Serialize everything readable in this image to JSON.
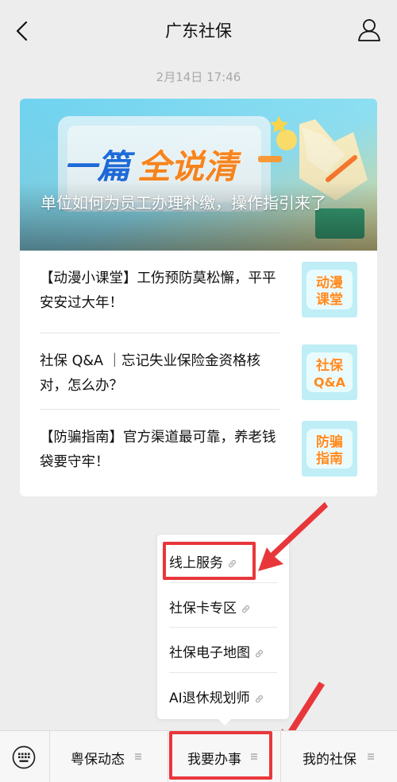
{
  "header": {
    "title": "广东社保"
  },
  "timestamp": "2月14日 17:46",
  "banner": {
    "headline": "一篇全说清",
    "caption": "单位如何为员工办理补缴，操作指引来了"
  },
  "articles": [
    {
      "title": "【动漫小课堂】工伤预防莫松懈，平平安安过大年！",
      "thumb_text": "动漫课堂"
    },
    {
      "title": "社保 Q&A ｜忘记失业保险金资格核对，怎么办？",
      "thumb_text": "社保Q&A"
    },
    {
      "title": "【防骗指南】官方渠道最可靠，养老钱袋要守牢！",
      "thumb_text": "防骗指南"
    }
  ],
  "submenu": {
    "items": [
      {
        "label": "线上服务"
      },
      {
        "label": "社保卡专区"
      },
      {
        "label": "社保电子地图"
      },
      {
        "label": "AI退休规划师"
      }
    ]
  },
  "bottom_menu": {
    "tabs": [
      {
        "label": "粤保动态"
      },
      {
        "label": "我要办事"
      },
      {
        "label": "我的社保"
      }
    ]
  },
  "colors": {
    "highlight": "#e8373b",
    "banner_blue": "#1e6fe0",
    "banner_orange": "#ff8a1f"
  },
  "icons": [
    "back-arrow-icon",
    "profile-icon",
    "link-icon",
    "keyboard-icon",
    "menu-lines-icon"
  ]
}
